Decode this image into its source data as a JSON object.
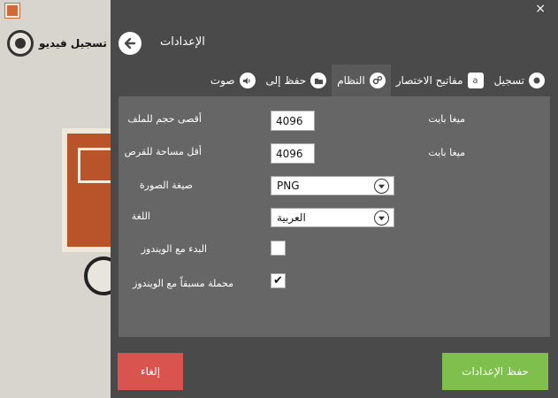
{
  "background_app": {
    "record_label": "تسجيل فيديو"
  },
  "panel": {
    "close_symbol": "×",
    "title": "الإعدادات",
    "tabs": [
      {
        "label": "تسجيل",
        "icon": "record-icon"
      },
      {
        "label": "مفاتيح الاختصار",
        "icon": "keyboard-icon",
        "icon_glyph": "a"
      },
      {
        "label": "النظام",
        "icon": "gears-icon"
      },
      {
        "label": "حفظ إلى",
        "icon": "folder-icon"
      },
      {
        "label": "صوت",
        "icon": "speaker-icon"
      }
    ],
    "active_tab": "النظام"
  },
  "settings": {
    "max_file_size": {
      "label": "أقصى حجم للملف",
      "value": "4096",
      "unit": "ميغا بايت"
    },
    "min_disk_space": {
      "label": "أقل مساحة للقرص",
      "value": "4096",
      "unit": "ميغا بايت"
    },
    "image_format": {
      "label": "صيغة الصورة",
      "value": "PNG"
    },
    "language": {
      "label": "اللغة",
      "value": "العربية"
    },
    "start_with_windows": {
      "label": "البدء مع الويندوز",
      "checked": false
    },
    "preload_with_windows": {
      "label": "محملة مسبقاً مع الويندوز",
      "checked": true,
      "check_glyph": "✔"
    }
  },
  "footer": {
    "cancel_label": "إلغاء",
    "save_label": "حفظ الإعدادات"
  },
  "colors": {
    "panel_bg": "#4a4a4a",
    "content_bg": "#666666",
    "cancel": "#d9534f",
    "save": "#7fbf4d",
    "brand": "#cf6a34"
  }
}
